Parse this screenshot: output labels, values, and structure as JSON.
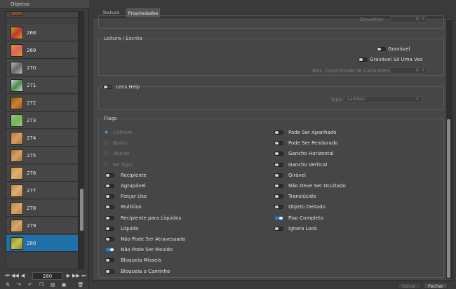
{
  "objects_panel": {
    "title": "Objetos",
    "items": [
      {
        "id": "268",
        "color": "#c8a020",
        "accent": "#c0392b"
      },
      {
        "id": "269",
        "color": "#d4a020",
        "accent": "#e06060"
      },
      {
        "id": "270",
        "color": "#b8b8b8",
        "accent": "#6a6a6a"
      },
      {
        "id": "271",
        "color": "#d8d8d8",
        "accent": "#4a8a4a"
      },
      {
        "id": "272",
        "color": "#8a5a2a",
        "accent": "#d08030"
      },
      {
        "id": "273",
        "color": "#b0b0b0",
        "accent": "#6abf40"
      },
      {
        "id": "274",
        "color": "#b07a3a",
        "accent": "#d8a060"
      },
      {
        "id": "275",
        "color": "#a8743a",
        "accent": "#d8a060"
      },
      {
        "id": "276",
        "color": "#c8925a",
        "accent": "#e0b070"
      },
      {
        "id": "277",
        "color": "#c08850",
        "accent": "#e0b070"
      },
      {
        "id": "278",
        "color": "#b8844a",
        "accent": "#d8a868"
      },
      {
        "id": "279",
        "color": "#b08048",
        "accent": "#d8a868"
      },
      {
        "id": "280",
        "color": "#8a8a30",
        "accent": "#c8c050"
      }
    ],
    "selected": "280",
    "page": "280"
  },
  "tabs": [
    {
      "label": "Textura"
    },
    {
      "label": "Propriedades"
    }
  ],
  "elevation": {
    "label": "Elevation:",
    "value": "0"
  },
  "leitura": {
    "title": "Leitura / Escrita",
    "gravavel": "Gravável",
    "gravavel_uma_vez": "Gravável Só Uma Vez",
    "max_caracteres_label": "Máx. Quantidade de Caracteres",
    "max_caracteres_value": "0"
  },
  "lens": {
    "toggle_label": "Lens Help",
    "type_label": "Type:",
    "type_value": "Ladders"
  },
  "flags": {
    "title": "Flags",
    "radios": [
      {
        "label": "Comum",
        "on": true
      },
      {
        "label": "Borda",
        "on": false
      },
      {
        "label": "Abaixo",
        "on": false
      },
      {
        "label": "No Topo",
        "on": false
      }
    ],
    "left": [
      {
        "label": "Recipiente",
        "on": false
      },
      {
        "label": "Agrupável",
        "on": false
      },
      {
        "label": "Forçar Uso",
        "on": false
      },
      {
        "label": "Multiúso",
        "on": false
      },
      {
        "label": "Recipiente para Líquidos",
        "on": false
      },
      {
        "label": "Líquido",
        "on": false
      },
      {
        "label": "Não Pode Ser Atravessado",
        "on": false
      },
      {
        "label": "Não Pode Ser Movido",
        "on": true
      },
      {
        "label": "Bloqueia Mísseis",
        "on": false
      },
      {
        "label": "Bloqueia o Caminho",
        "on": false
      }
    ],
    "right": [
      {
        "label": "Pode Ser Apanhado",
        "on": false
      },
      {
        "label": "Pode Ser Pendurado",
        "on": false
      },
      {
        "label": "Gancho Horizontal",
        "on": false
      },
      {
        "label": "Gancho Vertical",
        "on": false
      },
      {
        "label": "Girável",
        "on": false
      },
      {
        "label": "Não Deve Ser Ocultado",
        "on": false
      },
      {
        "label": "Translúcido",
        "on": false
      },
      {
        "label": "Objeto Deitado",
        "on": false
      },
      {
        "label": "Piso Completo",
        "on": true
      },
      {
        "label": "Ignora Look",
        "on": false
      }
    ]
  },
  "buttons": {
    "save": "Salvar",
    "close": "Fechar"
  }
}
